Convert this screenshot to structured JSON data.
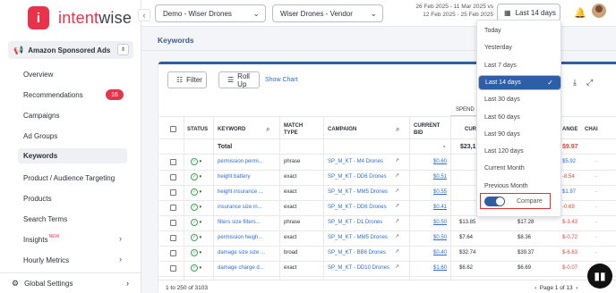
{
  "brand": {
    "mark": "i",
    "name_pre": "intent",
    "name_post": "wise"
  },
  "sidebar": {
    "product": "Amazon Sponsored Ads",
    "items": [
      {
        "label": "Overview"
      },
      {
        "label": "Recommendations",
        "badge": "16"
      },
      {
        "label": "Campaigns"
      },
      {
        "label": "Ad Groups"
      },
      {
        "label": "Keywords"
      },
      {
        "label": "Product / Audience Targeting"
      },
      {
        "label": "Products"
      },
      {
        "label": "Search Terms"
      },
      {
        "label": "Insights",
        "tag": "NEW"
      },
      {
        "label": "Hourly Metrics"
      }
    ],
    "footer": "Global Settings"
  },
  "header": {
    "account": "Demo - Wiser Drones",
    "profile": "Wiser Drones - Vendor",
    "range_line1": "26 Feb 2025 - 11 Mar 2025 vs",
    "range_line2": "12 Feb 2025 - 25 Feb 2025",
    "date_button": "Last 14 days"
  },
  "page": {
    "title": "Keywords"
  },
  "toolbar": {
    "filter": "Filter",
    "rollup": "Roll Up",
    "show_chart": "Show Chart"
  },
  "table": {
    "group_header": "SPEND",
    "headers": {
      "status": "STATUS",
      "keyword": "KEYWORD",
      "match1": "MATCH",
      "match2": "TYPE",
      "campaign": "CAMPAIGN",
      "bid1": "CURRENT",
      "bid2": "BID",
      "cur": "CURR",
      "change": "ANGE",
      "cha": "CHAI"
    },
    "total": {
      "label": "Total",
      "bid": "-",
      "cur": "$23,1",
      "change": "$9.97"
    },
    "rows": [
      {
        "keyword": "permission permi...",
        "match": "phrase",
        "campaign": "SP_M_KT - M4 Drones",
        "bid": "$0.60",
        "prev": "",
        "cur": "",
        "change": "$5.92",
        "pos": true
      },
      {
        "keyword": "height battery",
        "match": "exact",
        "campaign": "SP_M_KT - DD6 Drones",
        "bid": "$0.51",
        "prev": "",
        "cur": "",
        "change": "-8.54",
        "pos": false
      },
      {
        "keyword": "height insurance ...",
        "match": "exact",
        "campaign": "SP_M_KT - MM5 Drones",
        "bid": "$0.55",
        "prev": "",
        "cur": "",
        "change": "$1.97",
        "pos": true
      },
      {
        "keyword": "insurance size in...",
        "match": "exact",
        "campaign": "SP_M_KT - DD6 Drones",
        "bid": "$0.41",
        "prev": "",
        "cur": "",
        "change": "-0.69",
        "pos": false
      },
      {
        "keyword": "filters size filters...",
        "match": "phrase",
        "campaign": "SP_M_KT - D1 Drones",
        "bid": "$0.50",
        "prev": "$13.85",
        "cur": "$17.28",
        "change": "$-3.43",
        "pos": false
      },
      {
        "keyword": "permission heigh...",
        "match": "exact",
        "campaign": "SP_M_KT - MM5 Drones",
        "bid": "$0.50",
        "prev": "$7.64",
        "cur": "$8.36",
        "change": "$-0.72",
        "pos": false
      },
      {
        "keyword": "damage size size ...",
        "match": "broad",
        "campaign": "SP_M_KT - BB6 Drones",
        "bid": "$0.40",
        "prev": "$32.74",
        "cur": "$39.37",
        "change": "$-6.63",
        "pos": false
      },
      {
        "keyword": "damage charge d...",
        "match": "exact",
        "campaign": "SP_M_KT - DD10 Drones",
        "bid": "$1.60",
        "prev": "$6.62",
        "cur": "$6.69",
        "change": "$-0.07",
        "pos": false
      }
    ],
    "footer_left": "1 to 250 of 3103",
    "footer_right": "Page 1 of 13"
  },
  "date_dropdown": {
    "options": [
      "Today",
      "Yesterday",
      "Last 7 days",
      "Last 14 days",
      "Last 30 days",
      "Last 60 days",
      "Last 90 days",
      "Last 120 days",
      "Current Month",
      "Previous Month"
    ],
    "selected": "Last 14 days",
    "compare_label": "Compare",
    "compare_on": true
  },
  "colors": {
    "brand_red": "#e8334a",
    "primary_blue": "#2d5fa6",
    "link_blue": "#2d6ed0",
    "negative": "#e0473b"
  }
}
